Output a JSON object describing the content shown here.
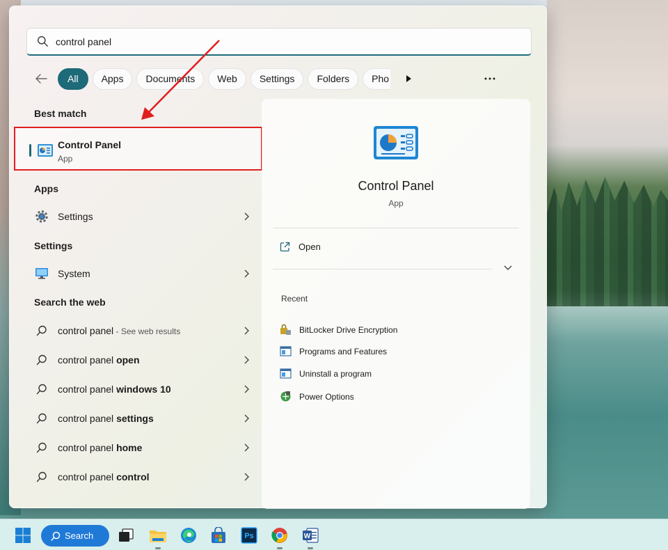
{
  "search": {
    "query": "control panel"
  },
  "filters": {
    "items": [
      "All",
      "Apps",
      "Documents",
      "Web",
      "Settings",
      "Folders",
      "Pho"
    ],
    "active": "All"
  },
  "sections": {
    "best_match": "Best match",
    "apps": "Apps",
    "settings": "Settings",
    "search_web": "Search the web"
  },
  "best_match": {
    "title": "Control Panel",
    "subtitle": "App"
  },
  "apps": [
    {
      "label": "Settings",
      "icon": "gear-icon"
    }
  ],
  "settings": [
    {
      "label": "System",
      "icon": "monitor-icon"
    }
  ],
  "web_results": [
    {
      "prefix": "control panel",
      "bold": "",
      "sub": " - See web results"
    },
    {
      "prefix": "control panel ",
      "bold": "open",
      "sub": ""
    },
    {
      "prefix": "control panel ",
      "bold": "windows 10",
      "sub": ""
    },
    {
      "prefix": "control panel ",
      "bold": "settings",
      "sub": ""
    },
    {
      "prefix": "control panel ",
      "bold": "home",
      "sub": ""
    },
    {
      "prefix": "control panel ",
      "bold": "control",
      "sub": ""
    }
  ],
  "detail": {
    "title": "Control Panel",
    "kind": "App",
    "open_label": "Open",
    "recent_label": "Recent",
    "recent": [
      {
        "label": "BitLocker Drive Encryption",
        "icon": "bitlocker-icon"
      },
      {
        "label": "Programs and Features",
        "icon": "programs-icon"
      },
      {
        "label": "Uninstall a program",
        "icon": "programs-icon"
      },
      {
        "label": "Power Options",
        "icon": "power-options-icon"
      }
    ]
  },
  "taskbar": {
    "search_label": "Search",
    "apps": [
      "windows-start-icon",
      "task-view-icon",
      "file-explorer-icon",
      "edge-icon",
      "store-icon",
      "photoshop-icon",
      "chrome-icon",
      "word-icon"
    ]
  },
  "colors": {
    "accent": "#1d6a78",
    "highlight_box": "#e01e1e",
    "annotation_arrow": "#e01e1e"
  }
}
